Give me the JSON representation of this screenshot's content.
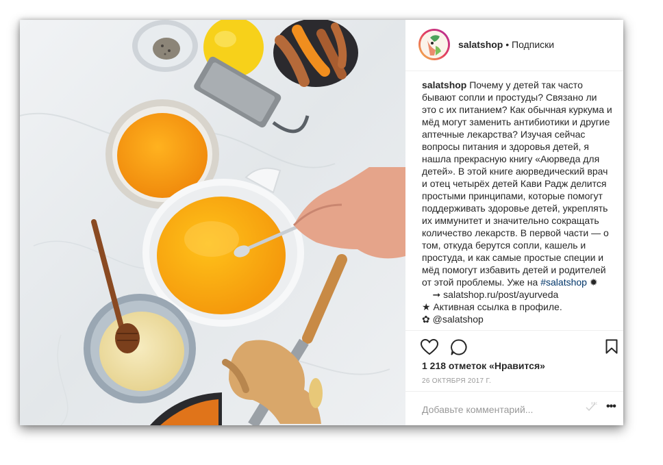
{
  "header": {
    "username": "salatshop",
    "separator": " • ",
    "follow_label": "Подписки"
  },
  "caption": {
    "username": "salatshop",
    "text": " Почему у детей так часто бывают сопли и простуды? Связано ли это с их питанием? Как обычная куркума и мёд могут заменить антибиотики и другие аптечные лекарства? Изучая сейчас вопросы питания и здоровья детей, я нашла прекрасную книгу «Аюрведа для детей». В этой книге аюрведический врач и отец четырёх детей Кави Радж делится простыми принципами, которые помогут поддерживать здоровье детей, укреплять их иммунитет и значительно сокращать количество лекарств. В первой части — о том, откуда берутся сопли, кашель и простуда, и как самые простые специи и мёд помогут избавить детей и родителей от этой проблемы. Уже на ",
    "hashtag": "#salatshop",
    "hashtag_after": " ✹",
    "link_line": "    ➞ salatshop.ru/post/ayurveda",
    "profile_line": "★ Активная ссылка в профиле.",
    "cut_line": "✿ @salatshop"
  },
  "stats": {
    "likes": "1 218 отметок «Нравится»",
    "date": "26 ОКТЯБРЯ 2017 Г."
  },
  "comment": {
    "placeholder": "Добавьте комментарий...",
    "more": "•••"
  },
  "icons": {
    "like": "heart-icon",
    "comment": "speech-bubble-icon",
    "save": "bookmark-icon",
    "more": "more-dots-icon"
  },
  "colors": {
    "text": "#262626",
    "hashtag": "#003569",
    "muted": "#999999",
    "divider": "#efefef"
  }
}
